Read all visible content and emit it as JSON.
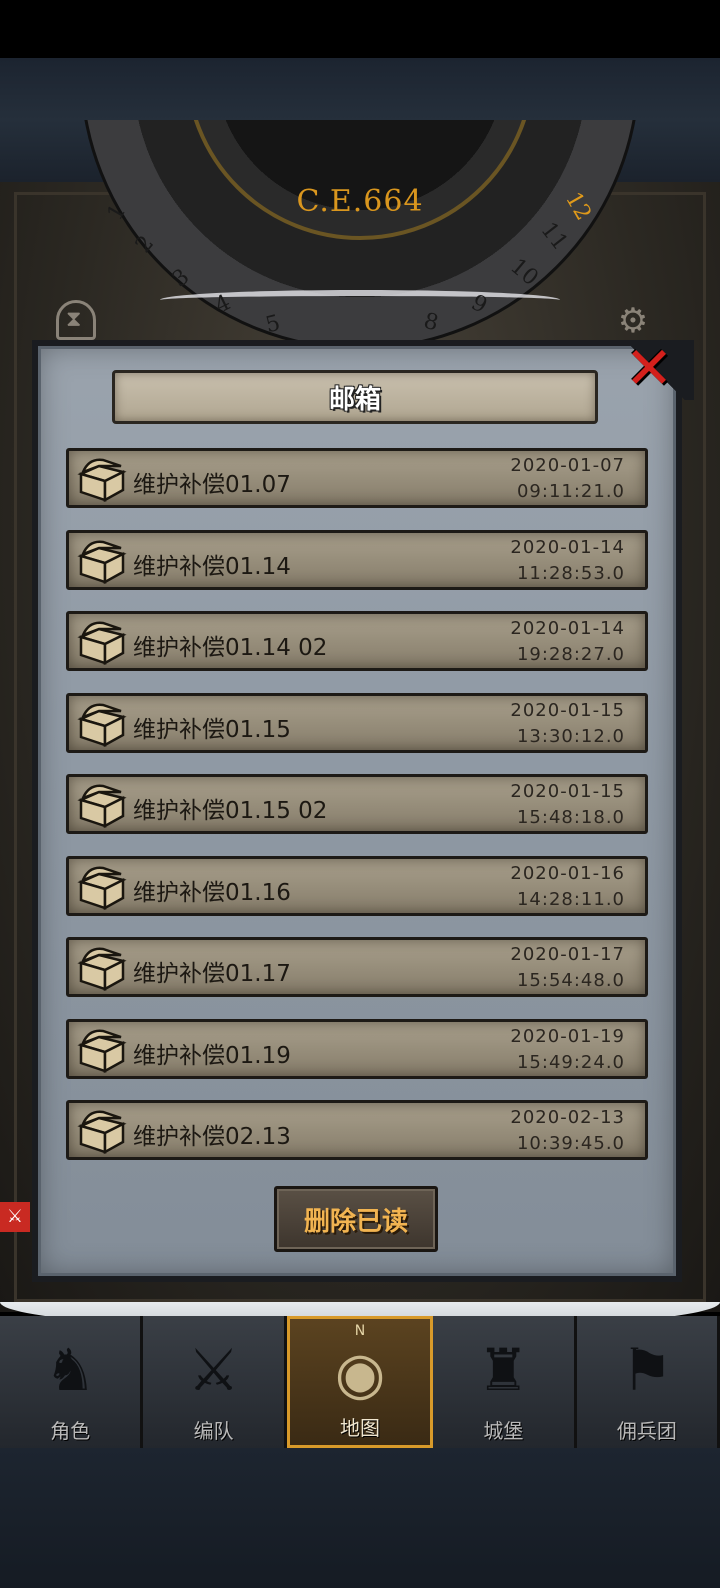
{
  "calendar": {
    "year": "C.E.664",
    "left_numbers": [
      "1",
      "2",
      "3",
      "4",
      "5"
    ],
    "right_numbers": [
      "8",
      "9",
      "10",
      "11"
    ],
    "current_month": "12"
  },
  "mailbox": {
    "title": "邮箱",
    "items": [
      {
        "title": "维护补偿01.07",
        "date": "2020-01-07",
        "time": "09:11:21.0"
      },
      {
        "title": "维护补偿01.14",
        "date": "2020-01-14",
        "time": "11:28:53.0"
      },
      {
        "title": "维护补偿01.14 02",
        "date": "2020-01-14",
        "time": "19:28:27.0"
      },
      {
        "title": "维护补偿01.15",
        "date": "2020-01-15",
        "time": "13:30:12.0"
      },
      {
        "title": "维护补偿01.15 02",
        "date": "2020-01-15",
        "time": "15:48:18.0"
      },
      {
        "title": "维护补偿01.16",
        "date": "2020-01-16",
        "time": "14:28:11.0"
      },
      {
        "title": "维护补偿01.17",
        "date": "2020-01-17",
        "time": "15:54:48.0"
      },
      {
        "title": "维护补偿01.19",
        "date": "2020-01-19",
        "time": "15:49:24.0"
      },
      {
        "title": "维护补偿02.13",
        "date": "2020-02-13",
        "time": "10:39:45.0"
      }
    ],
    "delete_read_label": "删除已读",
    "close_icon": "close-x-icon"
  },
  "nav": {
    "compass_letter": "N",
    "tabs": [
      {
        "label": "角色",
        "icon": "knight-icon",
        "glyph": "♞"
      },
      {
        "label": "编队",
        "icon": "formation-icon",
        "glyph": "⚔"
      },
      {
        "label": "地图",
        "icon": "compass-map-icon",
        "glyph": "◉"
      },
      {
        "label": "城堡",
        "icon": "castle-icon",
        "glyph": "♜"
      },
      {
        "label": "佣兵团",
        "icon": "mercenary-icon",
        "glyph": "⚑"
      }
    ],
    "active_tab": 2
  },
  "colors": {
    "accent_gold": "#d9961e",
    "close_red": "#d4201c",
    "delete_text": "#f2b451",
    "active_tab_border": "#d89a2a"
  }
}
